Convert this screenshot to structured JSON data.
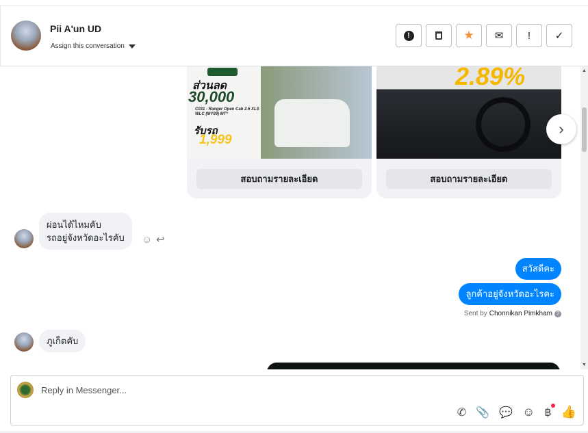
{
  "header": {
    "name": "Pii A'un UD",
    "assign_label": "Assign this conversation",
    "actions": [
      {
        "icon": "alert-circle-icon",
        "glyph": "❗"
      },
      {
        "icon": "trash-icon",
        "glyph": "🗑"
      },
      {
        "icon": "star-icon",
        "glyph": "★"
      },
      {
        "icon": "mark-unread-icon",
        "glyph": "✉"
      },
      {
        "icon": "exclamation-icon",
        "glyph": "!"
      },
      {
        "icon": "check-icon",
        "glyph": "✓"
      }
    ]
  },
  "carousel": {
    "cards": [
      {
        "button": "สอบถามรายละเอียด",
        "promo_discount_label": "ส่วนลด",
        "promo_discount": "30,000",
        "promo_model": "C031 - Ranger Open Cab 2.5 XLS WLC (MY09) MT*",
        "promo_down_label": "รับรถ",
        "promo_down": "1,999"
      },
      {
        "button": "สอบถามรายละเอียด",
        "promo_rate": "2.89%"
      }
    ]
  },
  "messages": [
    {
      "dir": "in",
      "lines": [
        "ผ่อนได้ไหมคับ",
        "รถอยู่จังหวัดอะไรคับ"
      ]
    },
    {
      "dir": "out",
      "text": "สวัสดีคะ"
    },
    {
      "dir": "out",
      "text": "ลูกค้าอยู่จังหวัดอะไรคะ"
    },
    {
      "dir": "in",
      "text": "ภูเก็ตคับ"
    }
  ],
  "sent_by": {
    "label": "Sent by",
    "name": "Chonnikan Pimkham"
  },
  "reply": {
    "placeholder": "Reply in Messenger...",
    "currency_glyph": "฿"
  },
  "colors": {
    "accent": "#0084ff",
    "star": "#f7923a",
    "badge": "#f02849"
  }
}
